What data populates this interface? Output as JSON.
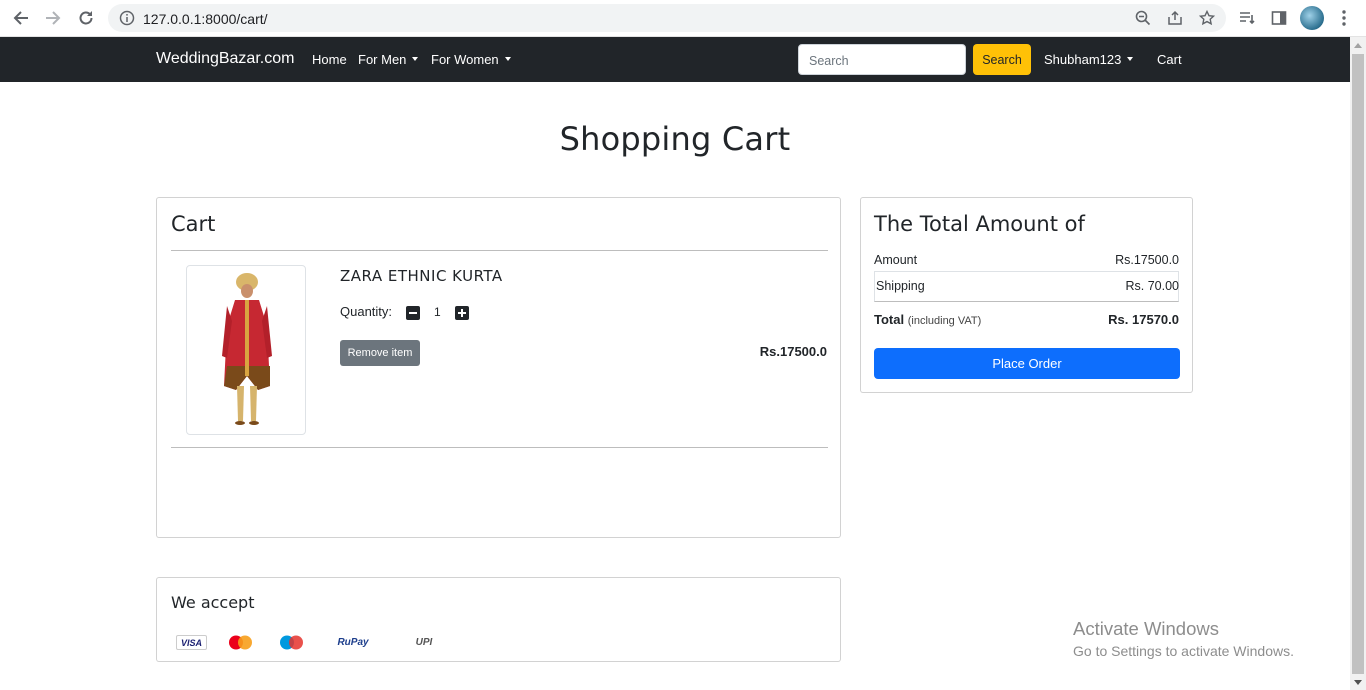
{
  "browser": {
    "url": "127.0.0.1:8000/cart/"
  },
  "navbar": {
    "brand": "WeddingBazar.com",
    "links": [
      "Home",
      "For Men",
      "For Women"
    ],
    "search_placeholder": "Search",
    "search_button": "Search",
    "user": "Shubham123",
    "cart": "Cart"
  },
  "page_title": "Shopping Cart",
  "cart": {
    "title": "Cart",
    "items": [
      {
        "name": "ZARA ETHNIC KURTA",
        "quantity_label": "Quantity:",
        "quantity": "1",
        "remove_label": "Remove item",
        "price": "Rs.17500.0"
      }
    ]
  },
  "summary": {
    "title": "The Total Amount of",
    "amount_label": "Amount",
    "amount_value": "Rs.17500.0",
    "shipping_label": "Shipping",
    "shipping_value": "Rs. 70.00",
    "total_label": "Total",
    "total_note": "(including VAT)",
    "total_value": "Rs. 17570.0",
    "place_order": "Place Order"
  },
  "payments": {
    "title": "We accept",
    "methods": [
      "VISA",
      "MasterCard",
      "Maestro",
      "RuPay",
      "UPI"
    ]
  },
  "watermark": {
    "line1": "Activate Windows",
    "line2": "Go to Settings to activate Windows."
  },
  "colors": {
    "navbar_bg": "#212529",
    "search_button": "#ffc107",
    "primary_button": "#0d6efd",
    "remove_button": "#6c757d"
  }
}
